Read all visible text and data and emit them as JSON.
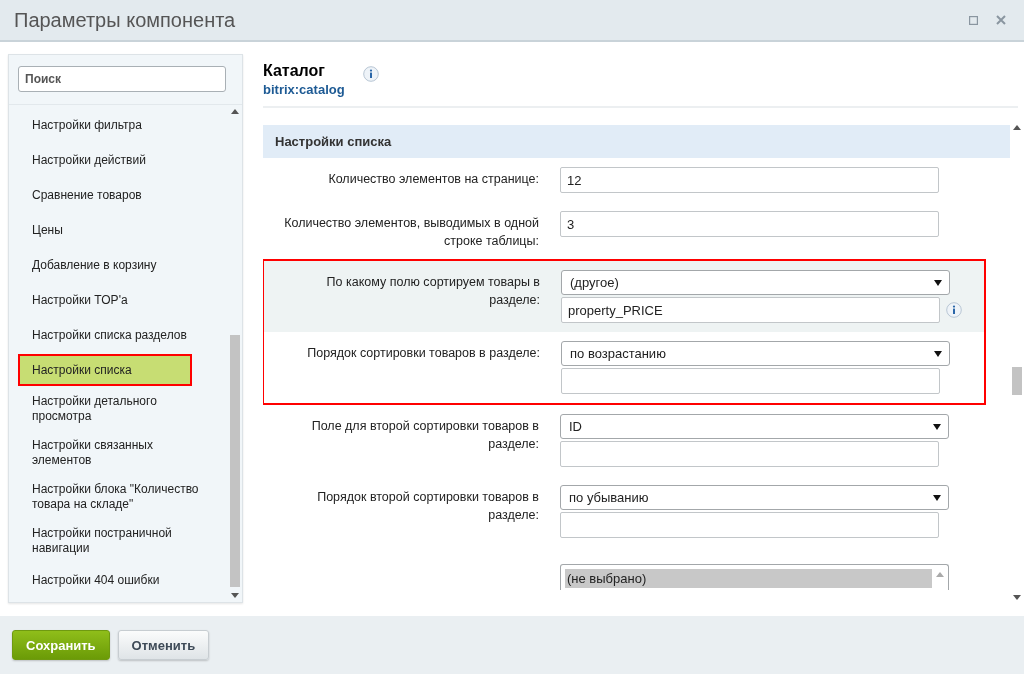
{
  "window": {
    "title": "Параметры компонента",
    "controls": [
      {
        "kind": "maximize"
      },
      {
        "kind": "close"
      }
    ]
  },
  "sidebar": {
    "search": {
      "placeholder": "Поиск"
    },
    "items": [
      {
        "label": "Настройки фильтра",
        "selected": false,
        "framed": false
      },
      {
        "label": "Настройки действий",
        "selected": false,
        "framed": false
      },
      {
        "label": "Сравнение товаров",
        "selected": false,
        "framed": false
      },
      {
        "label": "Цены",
        "selected": false,
        "framed": false
      },
      {
        "label": "Добавление в корзину",
        "selected": false,
        "framed": false
      },
      {
        "label": "Настройки TOP'а",
        "selected": false,
        "framed": false
      },
      {
        "label": "Настройки списка разделов",
        "selected": false,
        "framed": false
      },
      {
        "label": "Настройки списка",
        "selected": true,
        "framed": true
      },
      {
        "label": "Настройки детального просмотра",
        "selected": false,
        "framed": false
      },
      {
        "label": "Настройки связанных элементов",
        "selected": false,
        "framed": false
      },
      {
        "label": "Настройки блока \"Количество товара на складе\"",
        "selected": false,
        "framed": false
      },
      {
        "label": "Настройки постраничной навигации",
        "selected": false,
        "framed": false
      },
      {
        "label": "Настройки 404 ошибки",
        "selected": false,
        "framed": false
      }
    ]
  },
  "component": {
    "title": "Каталог",
    "code": "bitrix:catalog",
    "info": true
  },
  "section": {
    "title": "Настройки списка",
    "rows": [
      {
        "label": "Количество элементов на странице:",
        "highlighted": false,
        "framed": false,
        "info": false,
        "controls": [
          {
            "kind": "input",
            "value": "12"
          }
        ]
      },
      {
        "label": "Количество элементов, выводимых в одной строке таблицы:",
        "highlighted": false,
        "framed": false,
        "info": false,
        "controls": [
          {
            "kind": "input",
            "value": "3"
          }
        ]
      },
      {
        "label": "По какому полю сортируем товары в разделе:",
        "highlighted": true,
        "framed": true,
        "info": true,
        "controls": [
          {
            "kind": "select",
            "value": "(другое)"
          },
          {
            "kind": "input",
            "value": "property_PRICE"
          }
        ]
      },
      {
        "label": "Порядок сортировки товаров в разделе:",
        "highlighted": false,
        "framed": true,
        "info": false,
        "controls": [
          {
            "kind": "select",
            "value": "по возрастанию"
          },
          {
            "kind": "input"
          }
        ]
      },
      {
        "label": "Поле для второй сортировки товаров в разделе:",
        "highlighted": false,
        "framed": false,
        "info": false,
        "controls": [
          {
            "kind": "select",
            "value": "ID"
          },
          {
            "kind": "input"
          }
        ]
      },
      {
        "label": "Порядок второй сортировки товаров в разделе:",
        "highlighted": false,
        "framed": false,
        "info": false,
        "controls": [
          {
            "kind": "select",
            "value": "по убыванию"
          },
          {
            "kind": "input"
          }
        ]
      },
      {
        "highlighted": false,
        "framed": false,
        "info": false,
        "controls": [
          {
            "kind": "listbox",
            "options": [
              {
                "label": "(не выбрано)",
                "selected": true
              }
            ]
          }
        ]
      }
    ]
  },
  "buttons": [
    {
      "label": "Сохранить",
      "kind": "primary"
    },
    {
      "label": "Отменить",
      "kind": "secondary"
    }
  ]
}
